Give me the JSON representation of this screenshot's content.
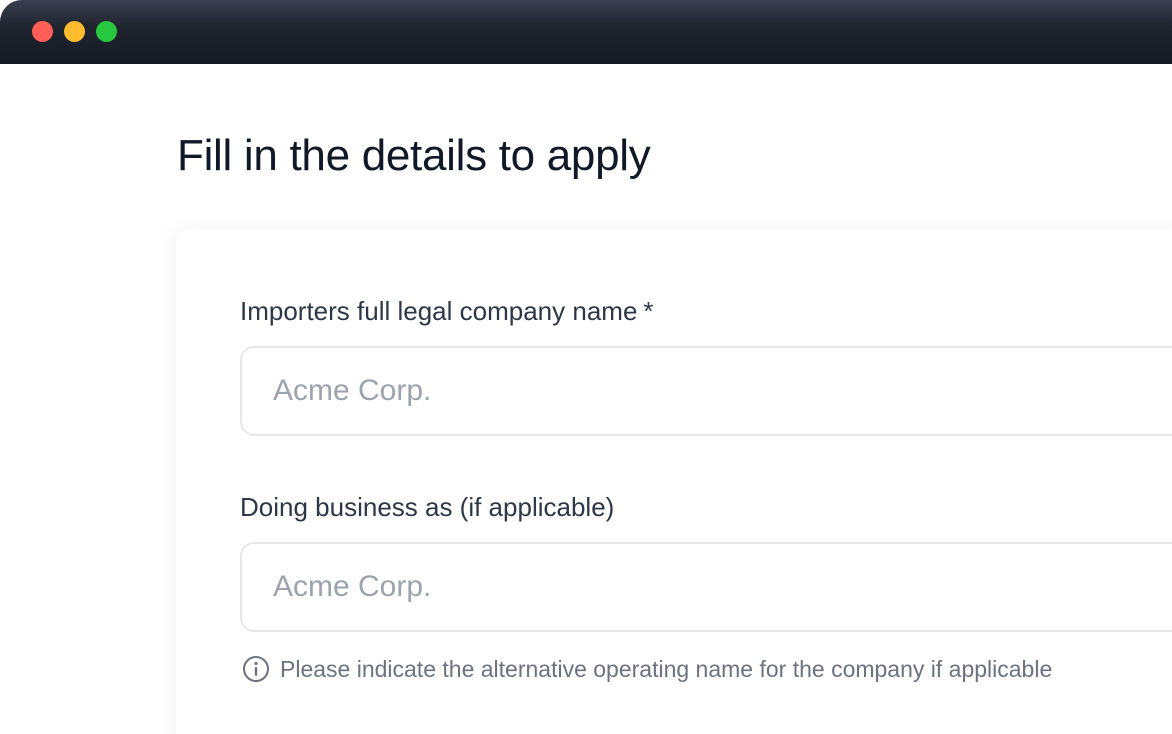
{
  "window": {
    "controls": {
      "close_color": "#ff5f57",
      "minimize_color": "#febc2e",
      "maximize_color": "#28c840"
    }
  },
  "page": {
    "title": "Fill in the details to apply"
  },
  "form": {
    "company_name": {
      "label": "Importers full legal company name",
      "required_mark": "*",
      "placeholder": "Acme Corp.",
      "value": ""
    },
    "dba": {
      "label": "Doing business as (if applicable)",
      "placeholder": "Acme Corp.",
      "value": "",
      "hint_icon": "info-icon",
      "hint": "Please indicate the alternative operating name for the company if applicable"
    }
  },
  "colors": {
    "title_text": "#111827",
    "label_text": "#2d3748",
    "placeholder_text": "#9ca3af",
    "hint_text": "#6b7280",
    "input_border": "#e5e7eb"
  }
}
